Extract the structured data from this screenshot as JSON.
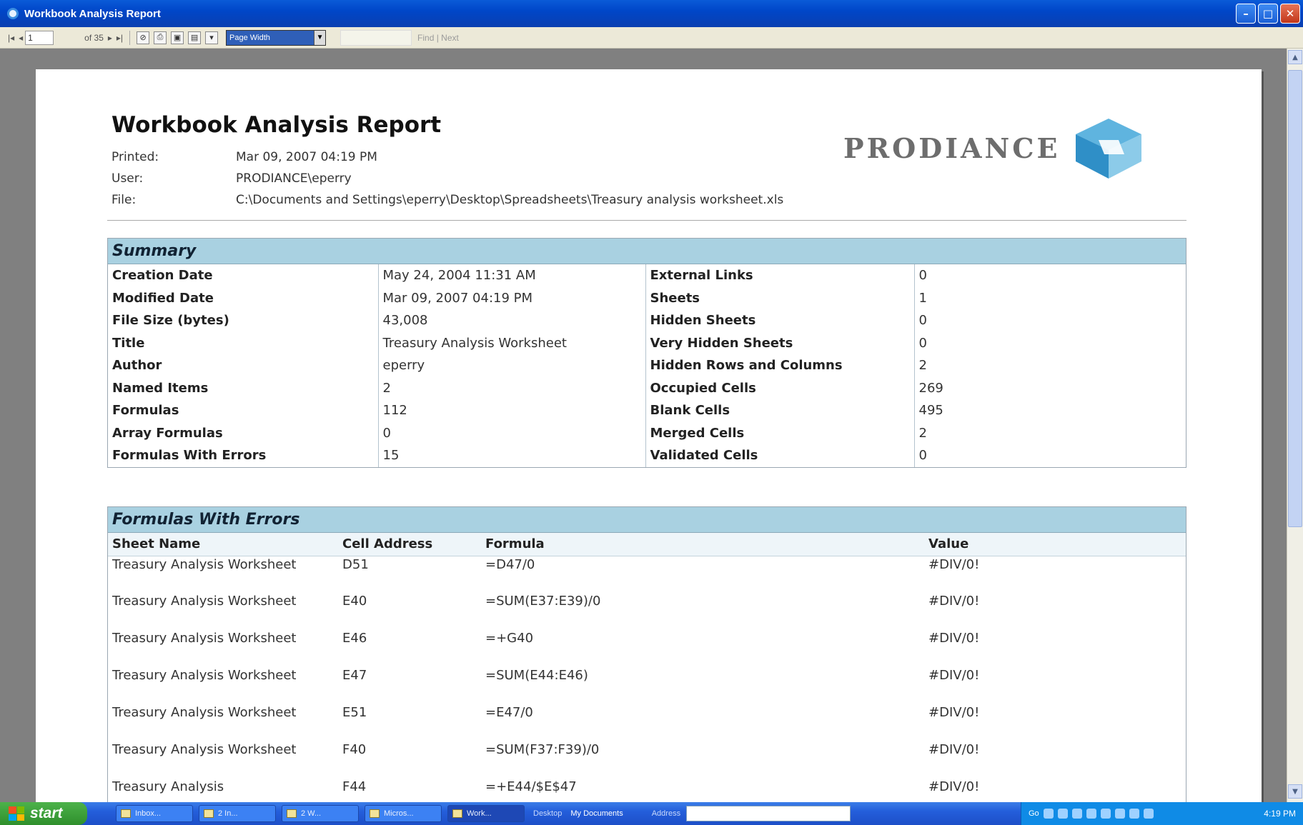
{
  "window": {
    "title": "Workbook Analysis Report"
  },
  "toolbar": {
    "current_page": "1",
    "page_count": "of 35",
    "zoom": "Page Width",
    "find_next": "Find | Next"
  },
  "report": {
    "title": "Workbook Analysis Report",
    "logo_text": "PRODIANCE",
    "meta": [
      {
        "label": "Printed:",
        "value": "Mar 09, 2007 04:19 PM"
      },
      {
        "label": "User:",
        "value": "PRODIANCE\\eperry"
      },
      {
        "label": "File:",
        "value": "C:\\Documents and Settings\\eperry\\Desktop\\Spreadsheets\\Treasury analysis worksheet.xls"
      }
    ],
    "summary": {
      "heading": "Summary",
      "rows": [
        [
          "Creation Date",
          "May 24, 2004 11:31 AM",
          "External Links",
          "0"
        ],
        [
          "Modified Date",
          "Mar 09, 2007 04:19 PM",
          "Sheets",
          "1"
        ],
        [
          "File Size (bytes)",
          "43,008",
          "Hidden Sheets",
          "0"
        ],
        [
          "Title",
          "Treasury Analysis Worksheet",
          "Very Hidden Sheets",
          "0"
        ],
        [
          "Author",
          "eperry",
          "Hidden Rows and Columns",
          "2"
        ],
        [
          "Named Items",
          "2",
          "Occupied Cells",
          "269"
        ],
        [
          "Formulas",
          "112",
          "Blank Cells",
          "495"
        ],
        [
          "Array Formulas",
          "0",
          "Merged Cells",
          "2"
        ],
        [
          "Formulas With Errors",
          "15",
          "Validated Cells",
          "0"
        ]
      ]
    },
    "errors": {
      "heading": "Formulas With Errors",
      "columns": [
        "Sheet Name",
        "Cell Address",
        "Formula",
        "Value"
      ],
      "rows": [
        [
          "Treasury Analysis Worksheet",
          "D51",
          "=D47/0",
          "#DIV/0!"
        ],
        [
          "Treasury Analysis Worksheet",
          "E40",
          "=SUM(E37:E39)/0",
          "#DIV/0!"
        ],
        [
          "Treasury Analysis Worksheet",
          "E46",
          "=+G40",
          "#DIV/0!"
        ],
        [
          "Treasury Analysis Worksheet",
          "E47",
          "=SUM(E44:E46)",
          "#DIV/0!"
        ],
        [
          "Treasury Analysis Worksheet",
          "E51",
          "=E47/0",
          "#DIV/0!"
        ],
        [
          "Treasury Analysis Worksheet",
          "F40",
          "=SUM(F37:F39)/0",
          "#DIV/0!"
        ],
        [
          "Treasury Analysis",
          "F44",
          "=+E44/$E$47",
          "#DIV/0!"
        ]
      ]
    }
  },
  "taskbar": {
    "start": "start",
    "tasks": [
      "Inbox...",
      "2 In...",
      "2 W...",
      "Micros...",
      "Work..."
    ],
    "desktop": "Desktop",
    "my_documents": "My Documents",
    "address": "Address",
    "go": "Go",
    "clock": "4:19 PM"
  },
  "colors": {
    "section_header": "#a9d1e1",
    "titlebar": "#0046c8",
    "logo_cube": "#2f8fc7"
  }
}
